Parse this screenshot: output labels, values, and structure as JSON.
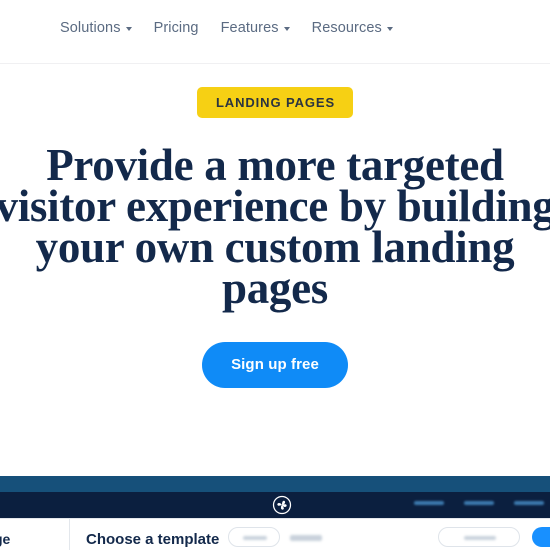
{
  "colors": {
    "brand_navy": "#13294b",
    "badge_yellow": "#f6d014",
    "cta_blue": "#0f8bf7",
    "nav_text": "#5b6b82",
    "app_band_blue": "#16507a",
    "app_bar_navy": "#0b1f3f"
  },
  "navbar": {
    "items": [
      {
        "label": "Solutions",
        "has_caret": true
      },
      {
        "label": "Pricing",
        "has_caret": false
      },
      {
        "label": "Features",
        "has_caret": true
      },
      {
        "label": "Resources",
        "has_caret": true
      }
    ]
  },
  "hero": {
    "badge": "LANDING PAGES",
    "headline": "Provide a more targeted\nvisitor experience by building\nyour own custom landing\npages",
    "cta_label": "Sign up free"
  },
  "product_preview": {
    "logo_icon": "pinwheel-logo-icon",
    "app_nav_placeholders": [
      "",
      "",
      ""
    ],
    "sidebar_label_truncated": "ge",
    "panel_title": "Choose a template",
    "toolbar_placeholders": [
      "",
      ""
    ],
    "footer_secondary_placeholder": "",
    "footer_primary_placeholder": ""
  }
}
